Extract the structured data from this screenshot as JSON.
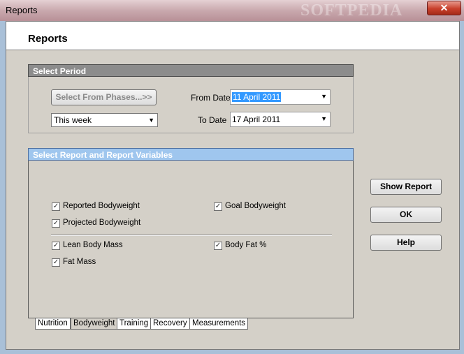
{
  "window": {
    "title": "Reports",
    "watermark": "SOFTPEDIA",
    "close_glyph": "✕"
  },
  "header": {
    "title": "Reports"
  },
  "period": {
    "section_title": "Select Period",
    "phases_button": "Select From Phases...>>",
    "period_value": "This week",
    "from_label": "From Date",
    "from_value": "11 April 2011",
    "to_label": "To Date",
    "to_value": "17 April 2011"
  },
  "report": {
    "section_title": "Select Report and Report Variables",
    "checkboxes": [
      {
        "label": "Reported Bodyweight",
        "checked": true
      },
      {
        "label": "Goal Bodyweight",
        "checked": true
      },
      {
        "label": "Projected Bodyweight",
        "checked": true
      },
      {
        "label": "Lean Body Mass",
        "checked": true
      },
      {
        "label": "Body Fat %",
        "checked": true
      },
      {
        "label": "Fat Mass",
        "checked": true
      }
    ]
  },
  "buttons": {
    "show_report": "Show Report",
    "ok": "OK",
    "help": "Help"
  },
  "tabs": [
    {
      "label": "Nutrition",
      "active": false
    },
    {
      "label": "Bodyweight",
      "active": true
    },
    {
      "label": "Training",
      "active": false
    },
    {
      "label": "Recovery",
      "active": false
    },
    {
      "label": "Measurements",
      "active": false
    }
  ]
}
